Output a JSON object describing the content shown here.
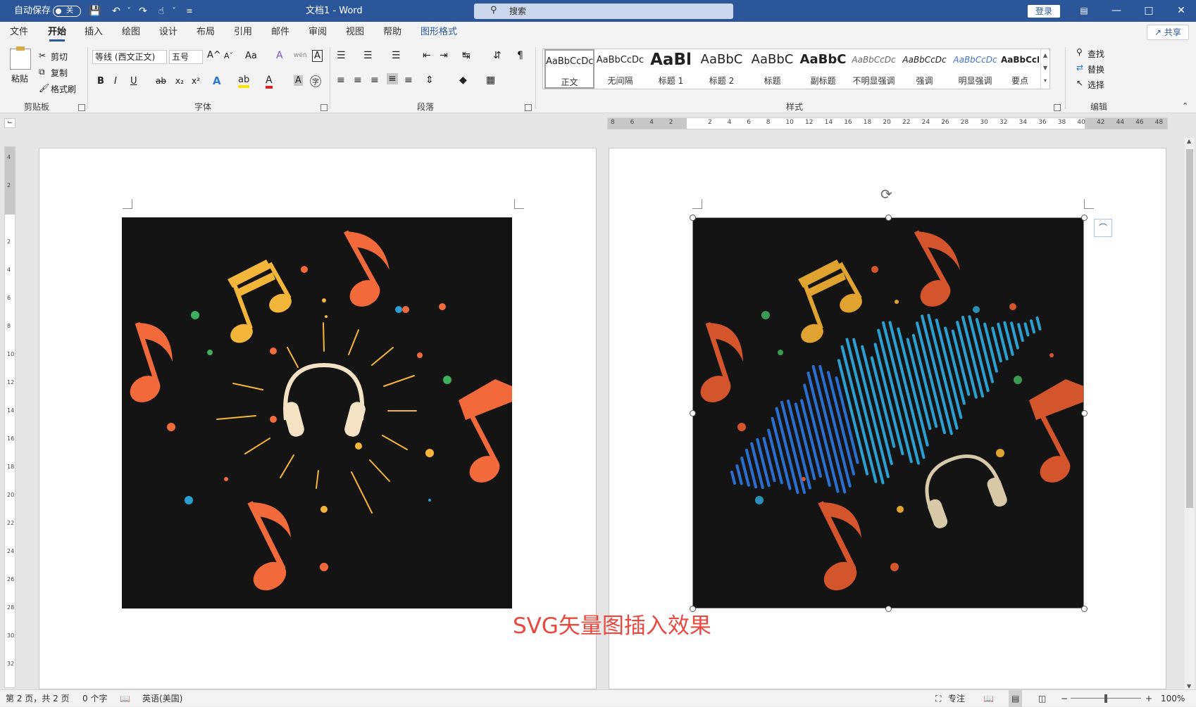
{
  "titlebar": {
    "autosave_label": "自动保存",
    "autosave_state": "关",
    "doc_title": "文档1 - Word",
    "search_placeholder": "搜索",
    "login_label": "登录"
  },
  "menu": {
    "tabs": [
      "文件",
      "开始",
      "插入",
      "绘图",
      "设计",
      "布局",
      "引用",
      "邮件",
      "审阅",
      "视图",
      "帮助",
      "图形格式"
    ],
    "active_tab": "开始",
    "share_label": "共享"
  },
  "ribbon": {
    "clipboard": {
      "label": "剪贴板",
      "paste": "粘贴",
      "cut": "剪切",
      "copy": "复制",
      "format_painter": "格式刷"
    },
    "font": {
      "label": "字体",
      "family": "等线 (西文正文)",
      "size": "五号",
      "bold": "B",
      "italic": "I",
      "underline": "U",
      "strike": "ab",
      "sub": "x₂",
      "sup": "x²",
      "grow": "A^",
      "shrink": "Aˇ",
      "case": "Aa",
      "clear": "A",
      "phonetic": "wén",
      "border": "A",
      "effects": "A",
      "highlight": "ab",
      "color": "A",
      "shade": "A",
      "enclose": "字"
    },
    "paragraph": {
      "label": "段落"
    },
    "styles": {
      "label": "样式",
      "items": [
        {
          "preview": "AaBbCcDc",
          "name": "正文"
        },
        {
          "preview": "AaBbCcDc",
          "name": "无间隔"
        },
        {
          "preview": "AaBl",
          "name": "标题 1"
        },
        {
          "preview": "AaBbC",
          "name": "标题 2"
        },
        {
          "preview": "AaBbC",
          "name": "标题"
        },
        {
          "preview": "AaBbC",
          "name": "副标题"
        },
        {
          "preview": "AaBbCcDc",
          "name": "不明显强调"
        },
        {
          "preview": "AaBbCcDc",
          "name": "强调"
        },
        {
          "preview": "AaBbCcDc",
          "name": "明显强调"
        },
        {
          "preview": "AaBbCcD",
          "name": "要点"
        }
      ]
    },
    "editing": {
      "label": "编辑",
      "find": "查找",
      "replace": "替换",
      "select": "选择"
    }
  },
  "ruler": {
    "h_ticks": [
      "8",
      "6",
      "4",
      "2",
      "",
      "2",
      "4",
      "6",
      "8",
      "10",
      "12",
      "14",
      "16",
      "18",
      "20",
      "22",
      "24",
      "26",
      "28",
      "30",
      "32",
      "34",
      "36",
      "38",
      "40",
      "42",
      "44",
      "46",
      "48"
    ],
    "v_ticks": [
      "4",
      "2",
      "",
      "2",
      "4",
      "6",
      "8",
      "10",
      "12",
      "14",
      "16",
      "18",
      "20",
      "22",
      "24",
      "26",
      "28",
      "30",
      "32"
    ]
  },
  "document": {
    "caption": "SVG矢量图插入效果"
  },
  "statusbar": {
    "page": "第 2 页，共 2 页",
    "words": "0 个字",
    "language": "英语(美国)",
    "focus": "专注",
    "zoom": "100%"
  },
  "colors": {
    "titlebar": "#2b579a",
    "accent": "#2b579a",
    "image_bg": "#141414",
    "orange": "#f26a3b",
    "yellow": "#f4b63a",
    "cream": "#f3e2c4",
    "blue": "#2a9fd0",
    "green": "#3fae5c",
    "caption": "#e8483d"
  }
}
